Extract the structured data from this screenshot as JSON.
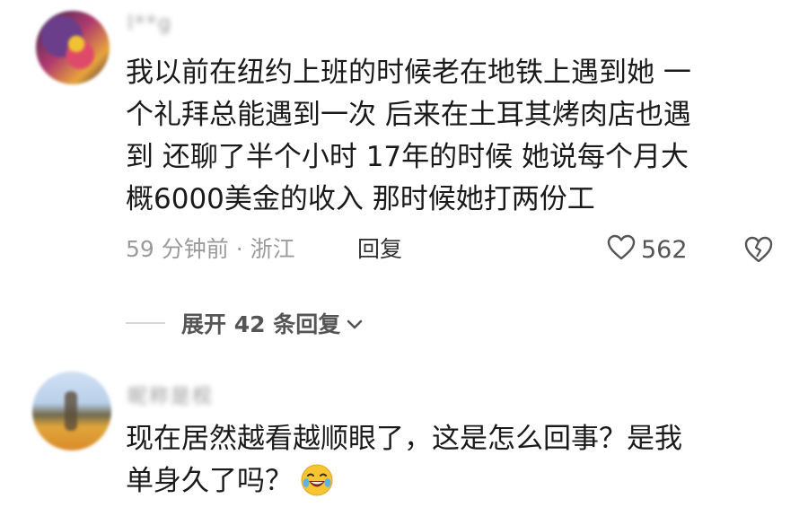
{
  "comments": [
    {
      "username": "l**g",
      "lines": [
        "我以前在纽约上班的时候老在地铁上遇到她 一",
        "个礼拜总能遇到一次 后来在土耳其烤肉店也遇",
        "到 还聊了半个小时  17年的时候 她说每个月大",
        "概6000美金的收入 那时候她打两份工"
      ],
      "meta": "59 分钟前 · 浙江",
      "reply_label": "回复",
      "likes": "562",
      "like_icon": "heart-outline-icon",
      "dislike_icon": "broken-heart-icon"
    },
    {
      "username": "昵称是枧",
      "lines": [
        "现在居然越看越顺眼了，这是怎么回事？是我",
        "单身久了吗？"
      ],
      "emoji": "laughing-crying-emoji"
    }
  ],
  "expand_replies": {
    "label": "展开 42 条回复",
    "icon": "chevron-down-icon"
  },
  "colors": {
    "text_primary": "#1a1a1a",
    "text_secondary": "#9b9b9b",
    "divider": "#d8d8d8"
  }
}
